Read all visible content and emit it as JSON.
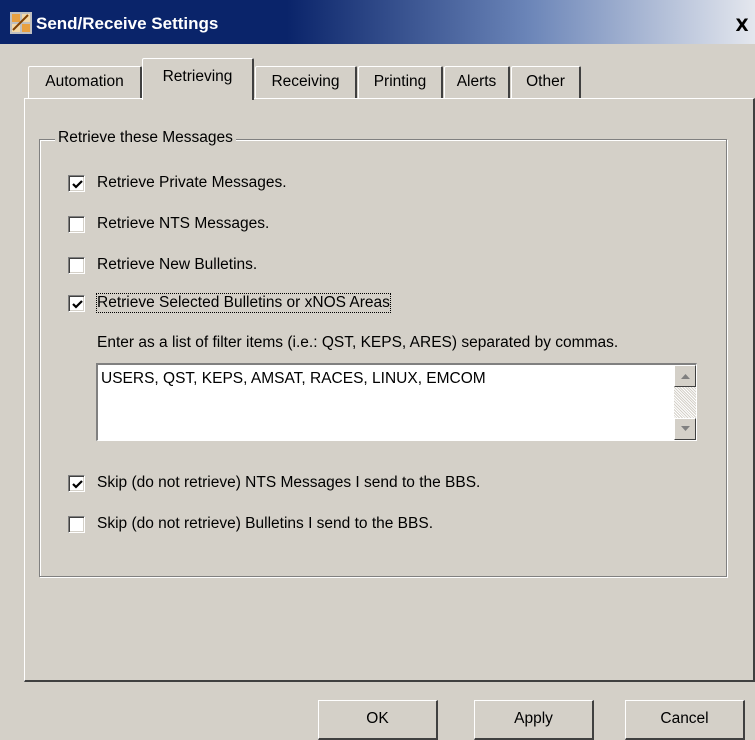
{
  "window": {
    "title": "Send/Receive Settings",
    "close_glyph": "X",
    "icon": "app-icon"
  },
  "tabs": [
    {
      "label": "Automation",
      "active": false
    },
    {
      "label": "Retrieving",
      "active": true
    },
    {
      "label": "Receiving",
      "active": false
    },
    {
      "label": "Printing",
      "active": false
    },
    {
      "label": "Alerts",
      "active": false
    },
    {
      "label": "Other",
      "active": false
    }
  ],
  "retrieve_group": {
    "legend": "Retrieve these Messages",
    "options": [
      {
        "label": "Retrieve Private Messages.",
        "checked": true
      },
      {
        "label": "Retrieve NTS Messages.",
        "checked": false
      },
      {
        "label": "Retrieve New Bulletins.",
        "checked": false
      },
      {
        "label": "Retrieve Selected Bulletins or xNOS Areas",
        "checked": true
      }
    ],
    "filter_instructions": "Enter as a list of filter items (i.e.: QST, KEPS, ARES) separated by commas.",
    "filter_value": "USERS, QST, KEPS, AMSAT, RACES, LINUX, EMCOM",
    "skip_options": [
      {
        "label": "Skip (do not retrieve) NTS Messages I send to the BBS.",
        "checked": true
      },
      {
        "label": "Skip (do not retrieve) Bulletins I send to the BBS.",
        "checked": false
      }
    ]
  },
  "buttons": {
    "ok": "OK",
    "apply": "Apply",
    "cancel": "Cancel"
  },
  "colors": {
    "dialog_face": "#d4d0c8",
    "titlebar_start": "#0a246a",
    "titlebar_end": "#e4e7ee"
  }
}
